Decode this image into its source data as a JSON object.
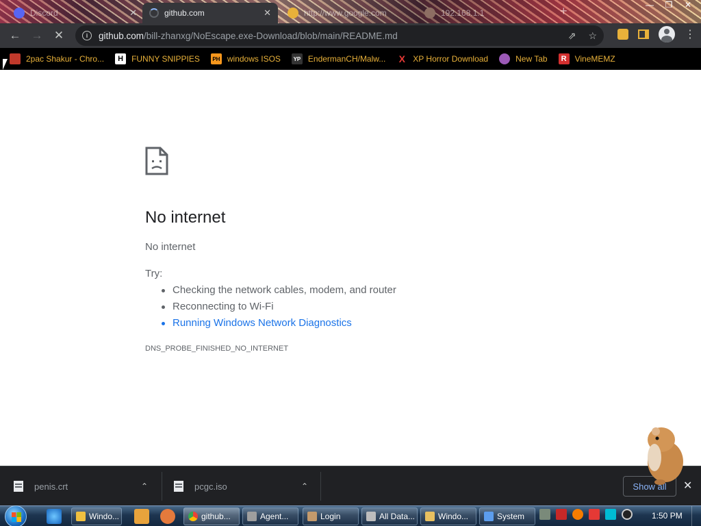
{
  "tabs": [
    {
      "label": "Discord",
      "state": "background"
    },
    {
      "label": "github.com",
      "state": "active-loading"
    },
    {
      "label": "http://www.google.com",
      "state": "background"
    },
    {
      "label": "192.168.1.1",
      "state": "background"
    }
  ],
  "omnibox": {
    "host": "github.com",
    "path": "/bill-zhanxg/NoEscape.exe-Download/blob/main/README.md"
  },
  "bookmarks": [
    {
      "label": "2pac Shakur - Chro...",
      "icon": "image-icon",
      "icon_text": "",
      "icon_bg": "#c0392b"
    },
    {
      "label": "FUNNY SNIPPIES",
      "icon": "h-icon",
      "icon_text": "H",
      "icon_bg": "#ffffff"
    },
    {
      "label": "windows ISOS",
      "icon": "ph-icon",
      "icon_text": "PH",
      "icon_bg": "#f7971d"
    },
    {
      "label": "EndermanCH/Malw...",
      "icon": "yp-icon",
      "icon_text": "YP",
      "icon_bg": "#333333"
    },
    {
      "label": "XP Horror Download",
      "icon": "x-icon",
      "icon_text": "X",
      "icon_bg": "transparent"
    },
    {
      "label": "New Tab",
      "icon": "globe-icon",
      "icon_text": "",
      "icon_bg": "#9b59b6"
    },
    {
      "label": "VineMEMZ",
      "icon": "r-icon",
      "icon_text": "R",
      "icon_bg": "#d32f2f"
    }
  ],
  "error": {
    "title": "No internet",
    "subtitle": "No internet",
    "try_label": "Try:",
    "suggestions": [
      "Checking the network cables, modem, and router",
      "Reconnecting to Wi-Fi",
      "Running Windows Network Diagnostics"
    ],
    "code": "DNS_PROBE_FINISHED_NO_INTERNET"
  },
  "downloads": {
    "items": [
      {
        "filename": "penis.crt"
      },
      {
        "filename": "pcgc.iso"
      }
    ],
    "show_all_label": "Show all"
  },
  "taskbar": {
    "tasks": [
      {
        "label": "Windo...",
        "icon_color": "#f0c040"
      },
      {
        "label": "github...",
        "icon_color": "#4caf50"
      },
      {
        "label": "Agent...",
        "icon_color": "#9e9e9e"
      },
      {
        "label": "Login",
        "icon_color": "#c49a6c"
      },
      {
        "label": "All Data...",
        "icon_color": "#bdbdbd"
      },
      {
        "label": "Windo...",
        "icon_color": "#e8c060"
      },
      {
        "label": "System",
        "icon_color": "#5c9ded"
      }
    ],
    "clock": "1:50 PM"
  },
  "colors": {
    "bookmark_text": "#e8b13a",
    "link": "#1a73e8",
    "chrome_dark": "#35363a"
  }
}
